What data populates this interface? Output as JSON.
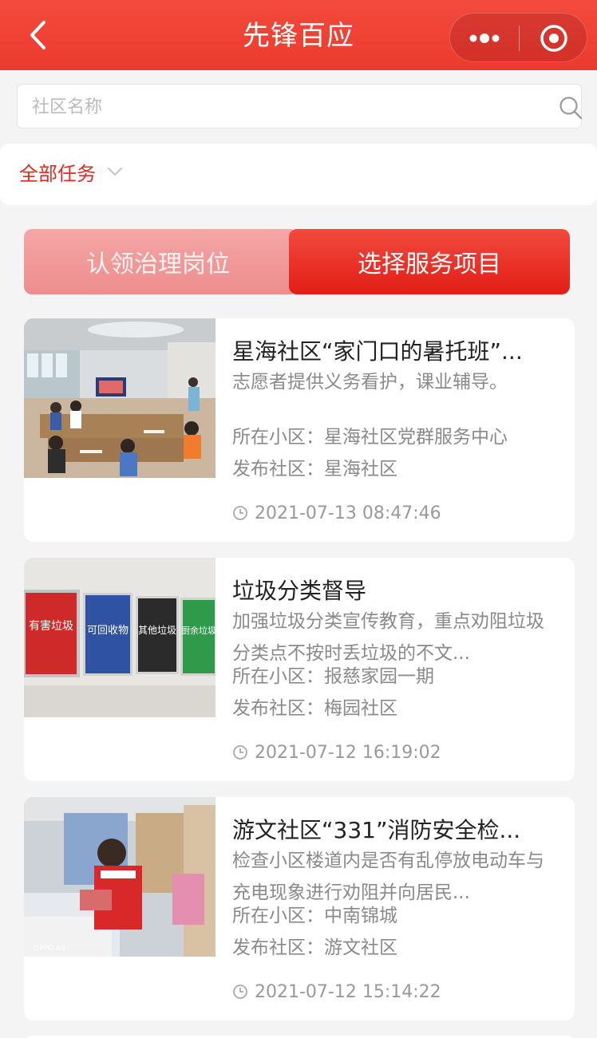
{
  "header": {
    "title": "先锋百应"
  },
  "search": {
    "placeholder": "社区名称",
    "value": ""
  },
  "filter": {
    "selected": "全部任务"
  },
  "tabs": [
    {
      "label": "认领治理岗位",
      "active": false
    },
    {
      "label": "选择服务项目",
      "active": true
    }
  ],
  "cards": [
    {
      "title": "星海社区“家门口的暑托班”...",
      "desc": "志愿者提供义务看护，课业辅导。",
      "community_area": "所在小区：星海社区党群服务中心",
      "publisher": "发布社区：星海社区",
      "time": "2021-07-13 08:47:46"
    },
    {
      "title": "垃圾分类督导",
      "desc": "加强垃圾分类宣传教育，重点劝阻垃圾分类点不按时丢垃圾的不文...",
      "community_area": "所在小区：报慈家园一期",
      "publisher": "发布社区：梅园社区",
      "time": "2021-07-12 16:19:02",
      "poster_texts": [
        "有害垃圾",
        "可回收物",
        "其他垃圾",
        "厨余垃圾"
      ]
    },
    {
      "title": "游文社区“331”消防安全检...",
      "desc": "检查小区楼道内是否有乱停放电动车与充电现象进行劝阻并向居民...",
      "community_area": "所在小区：中南锦城",
      "publisher": "发布社区：游文社区",
      "time": "2021-07-12 15:14:22",
      "photo_watermark": "OPPO A9"
    }
  ],
  "colors": {
    "primary": "#e21e17",
    "header": "#ec3a2e",
    "background": "#f4f4f4"
  }
}
